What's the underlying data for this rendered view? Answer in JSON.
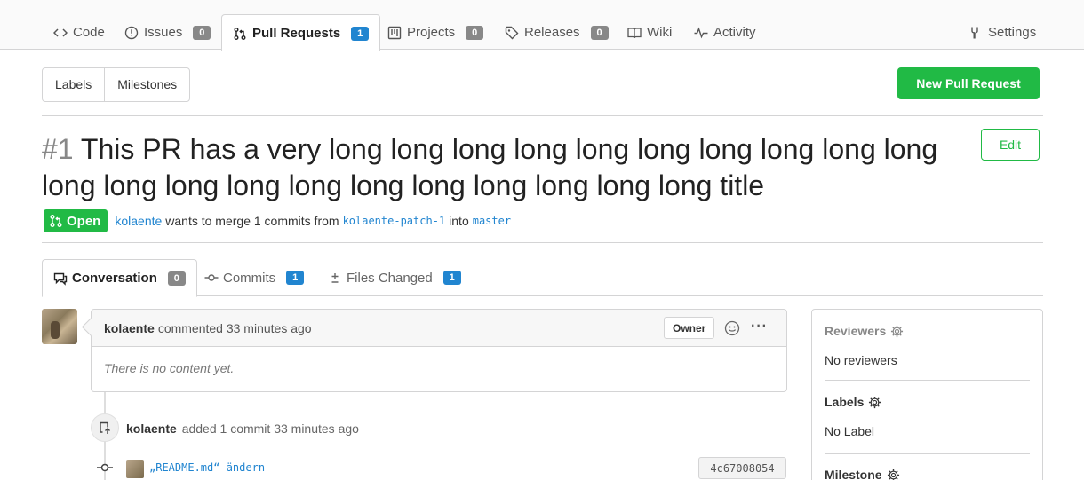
{
  "repo_tabs": [
    {
      "label": "Code",
      "icon": "code-icon"
    },
    {
      "label": "Issues",
      "icon": "issue-icon",
      "count": "0"
    },
    {
      "label": "Pull Requests",
      "icon": "pull-request-icon",
      "count": "1",
      "active": true
    },
    {
      "label": "Projects",
      "icon": "project-icon",
      "count": "0"
    },
    {
      "label": "Releases",
      "icon": "tag-icon",
      "count": "0"
    },
    {
      "label": "Wiki",
      "icon": "book-icon"
    },
    {
      "label": "Activity",
      "icon": "pulse-icon"
    },
    {
      "label": "Settings",
      "icon": "tools-icon"
    }
  ],
  "toolbar": {
    "labels": "Labels",
    "milestones": "Milestones",
    "new_pr": "New Pull Request"
  },
  "pr": {
    "number": "#1",
    "title": "This PR has a very long long long long long long long long long long long long long long long long long long long long long title",
    "edit": "Edit",
    "status": "Open",
    "author": "kolaente",
    "merge_text_1": "wants to merge 1 commits from",
    "head_branch": "kolaente-patch-1",
    "merge_text_2": "into",
    "base_branch": "master"
  },
  "pr_tabs": [
    {
      "label": "Conversation",
      "icon": "comment-icon",
      "count": "0",
      "active": true
    },
    {
      "label": "Commits",
      "icon": "commit-icon",
      "count": "1"
    },
    {
      "label": "Files Changed",
      "icon": "diff-icon",
      "count": "1"
    }
  ],
  "comment": {
    "author": "kolaente",
    "action": "commented 33 minutes ago",
    "badge": "Owner",
    "more": "···",
    "body": "There is no content yet."
  },
  "event": {
    "author": "kolaente",
    "text": "added 1 commit 33 minutes ago"
  },
  "commit": {
    "message": "„README.md“ ändern",
    "sha": "4c67008054"
  },
  "sidebar": {
    "reviewers_title": "Reviewers",
    "reviewers_value": "No reviewers",
    "labels_title": "Labels",
    "labels_value": "No Label",
    "milestone_title": "Milestone"
  },
  "colors": {
    "primary_green": "#21ba45",
    "link_blue": "#2185d0",
    "count_grey": "#888888"
  }
}
